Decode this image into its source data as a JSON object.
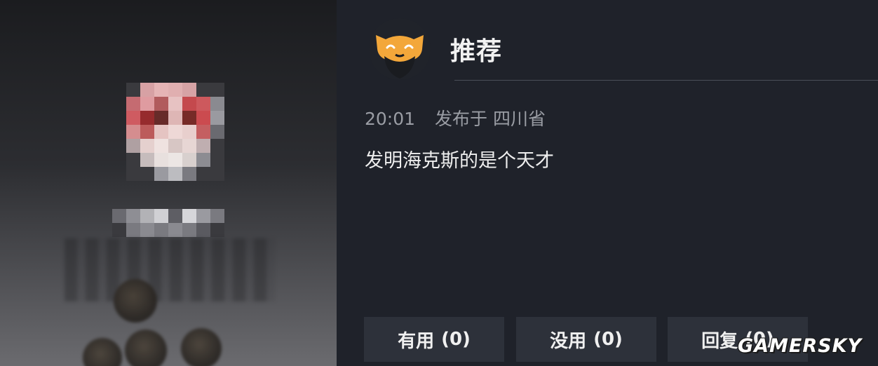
{
  "header": {
    "title": "推荐",
    "avatar_icon": "bearded-mascot-icon"
  },
  "comment": {
    "time": "20:01",
    "location": "发布于 四川省",
    "text": "发明海克斯的是个天才"
  },
  "actions": {
    "useful_label": "有用",
    "useful_count": "(0)",
    "useless_label": "没用",
    "useless_count": "(0)",
    "reply_label": "回复",
    "reply_count": "(0)"
  },
  "watermark": "GAMERSKY",
  "colors": {
    "background": "#1f222a",
    "button": "#2d313a",
    "avatar_orange": "#f3a73a",
    "text_primary": "#eeeeee",
    "text_secondary": "#9a9da4"
  }
}
